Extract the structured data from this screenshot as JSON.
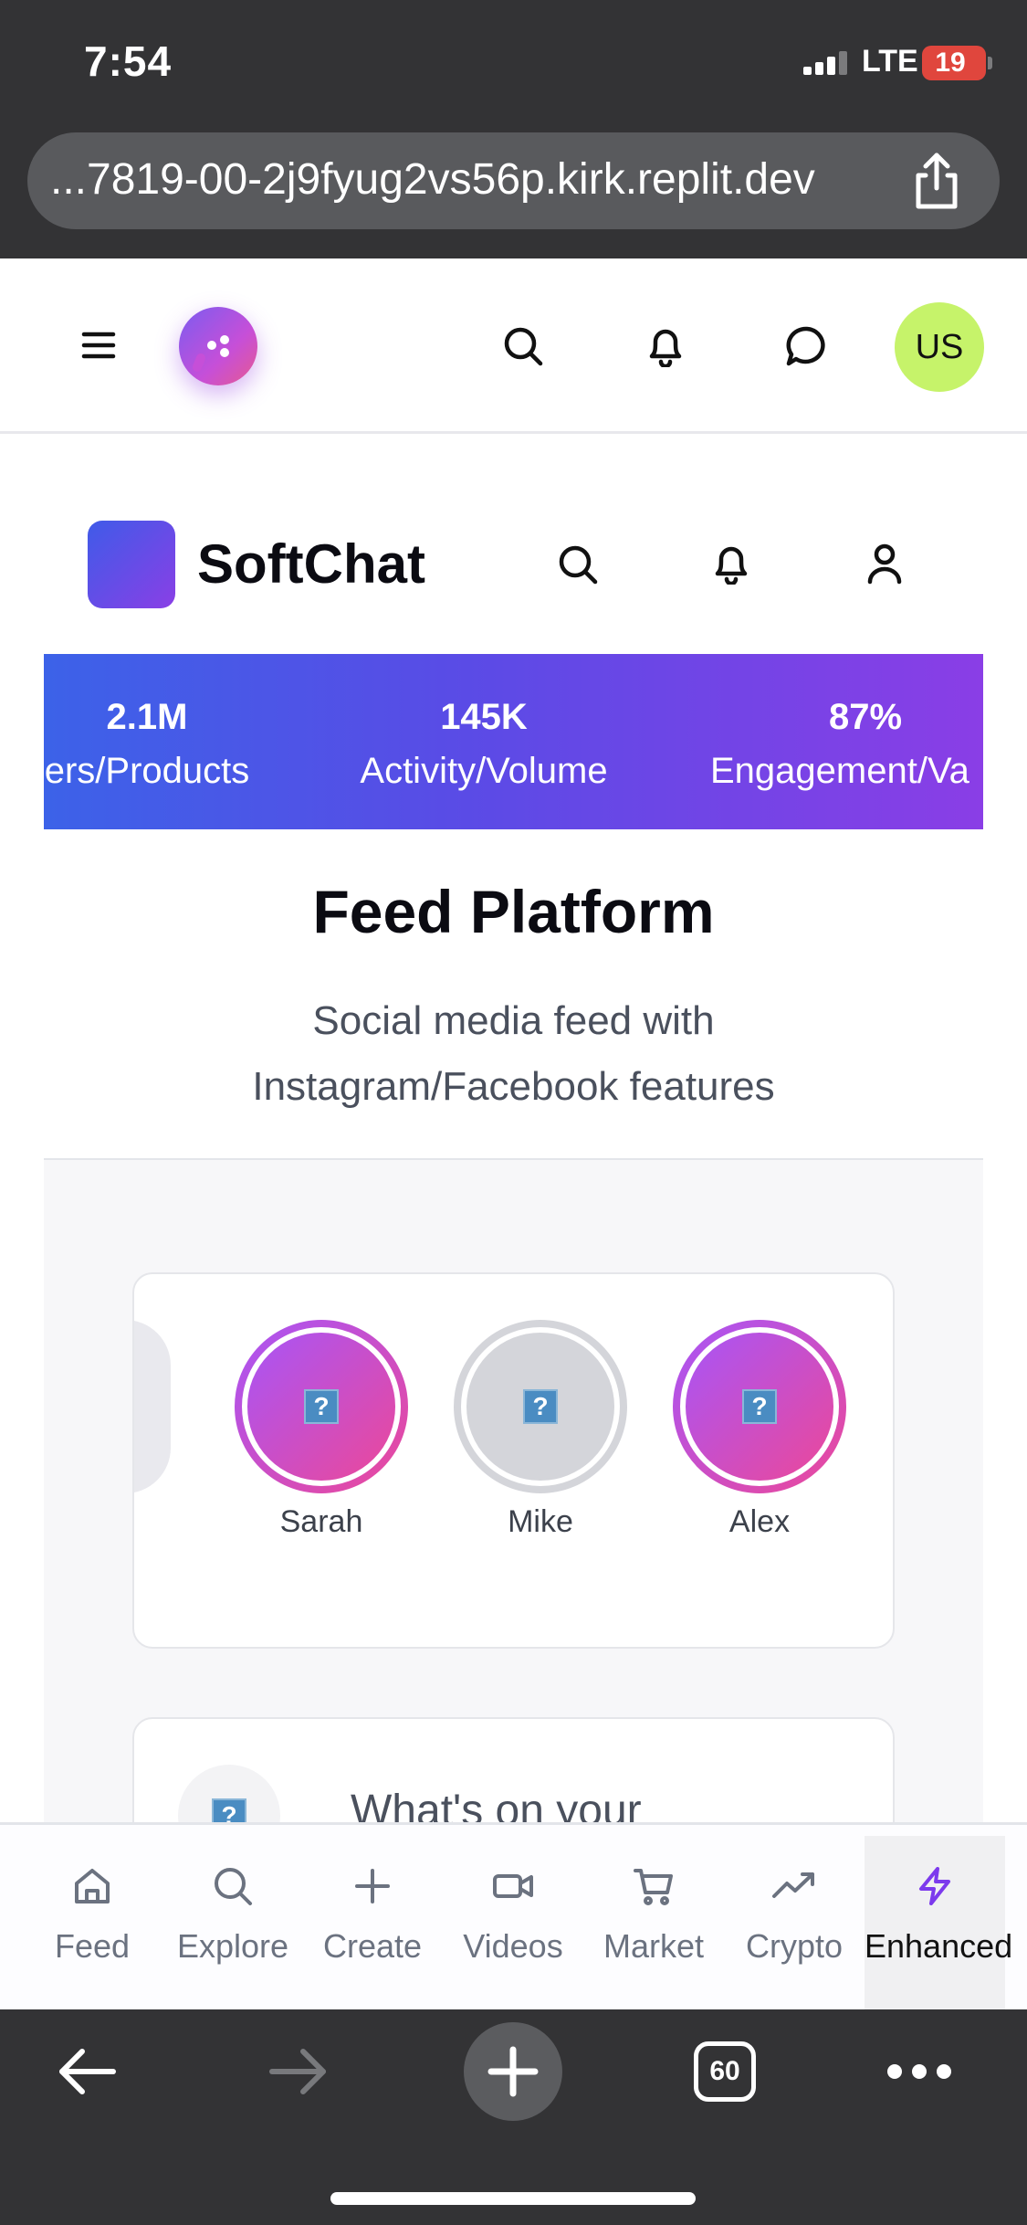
{
  "status_bar": {
    "time": "7:54",
    "network": "LTE",
    "battery": "19"
  },
  "browser": {
    "url": "...7819-00-2j9fyug2vs56p.kirk.replit.dev",
    "tab_count": "60"
  },
  "app_header": {
    "avatar_initials": "US",
    "icons": [
      "menu-icon",
      "chat-bubble-logo-icon",
      "search-icon",
      "bell-icon",
      "message-icon"
    ]
  },
  "brand_bar": {
    "name": "SoftChat",
    "icons": [
      "search-icon",
      "bell-icon",
      "user-icon"
    ]
  },
  "stats": [
    {
      "value": "2.1M",
      "label": "ers/Products"
    },
    {
      "value": "145K",
      "label": "Activity/Volume"
    },
    {
      "value": "87%",
      "label": "Engagement/Va"
    }
  ],
  "page": {
    "title": "Feed Platform",
    "subtitle": "Social media feed with Instagram/Facebook features"
  },
  "stories": [
    {
      "name": "Sarah",
      "seen": false
    },
    {
      "name": "Mike",
      "seen": true
    },
    {
      "name": "Alex",
      "seen": false
    }
  ],
  "composer": {
    "placeholder": "What's on your"
  },
  "bottom_nav": [
    {
      "label": "Feed",
      "icon": "home-icon"
    },
    {
      "label": "Explore",
      "icon": "search-icon"
    },
    {
      "label": "Create",
      "icon": "plus-icon"
    },
    {
      "label": "Videos",
      "icon": "video-icon"
    },
    {
      "label": "Market",
      "icon": "cart-icon"
    },
    {
      "label": "Crypto",
      "icon": "trending-up-icon"
    },
    {
      "label": "Enhanced",
      "icon": "lightning-icon",
      "active": true
    }
  ],
  "colors": {
    "accent": "#7c3aed",
    "avatar_bg": "#c6f36a",
    "banner_start": "#3c62e8",
    "banner_end": "#8a3ee6"
  }
}
